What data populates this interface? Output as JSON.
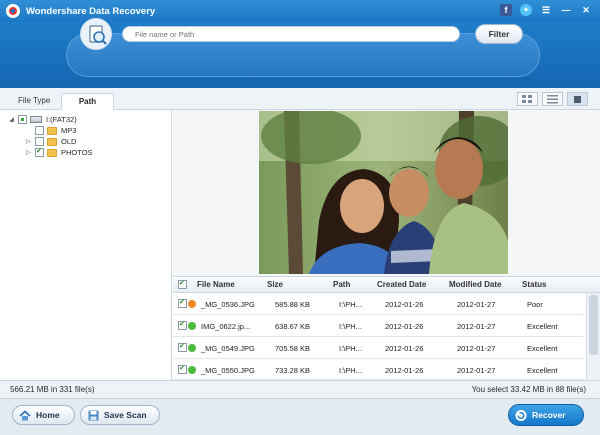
{
  "app": {
    "title": "Wondershare Data Recovery"
  },
  "search": {
    "placeholder": "File name or Path",
    "filter_label": "Filter"
  },
  "tabs": [
    {
      "label": "File Type"
    },
    {
      "label": "Path"
    }
  ],
  "tree": {
    "drive_label": "I:(FAT32)",
    "folders": [
      {
        "label": "MP3"
      },
      {
        "label": "OLD"
      },
      {
        "label": "PHOTOS"
      }
    ]
  },
  "table": {
    "headers": [
      "File Name",
      "Size",
      "Path",
      "Created Date",
      "Modified Date",
      "Status"
    ],
    "rows": [
      {
        "name": "_MG_0536.JPG",
        "size": "585.88 KB",
        "path": "I:\\PH...",
        "created": "2012-01-26",
        "modified": "2012-01-27",
        "status": "Poor",
        "status_color": "#f08a24"
      },
      {
        "name": "IMG_0622.jp...",
        "size": "638.67 KB",
        "path": "I:\\PH...",
        "created": "2012-01-26",
        "modified": "2012-01-27",
        "status": "Excellent",
        "status_color": "#4cbb3c"
      },
      {
        "name": "_MG_0549.JPG",
        "size": "705.58 KB",
        "path": "I:\\PH...",
        "created": "2012-01-26",
        "modified": "2012-01-27",
        "status": "Excellent",
        "status_color": "#4cbb3c"
      },
      {
        "name": "_MG_0550.JPG",
        "size": "733.28 KB",
        "path": "I:\\PH...",
        "created": "2012-01-26",
        "modified": "2012-01-27",
        "status": "Excellent",
        "status_color": "#4cbb3c"
      }
    ]
  },
  "status": {
    "left": "566.21 MB in 331 file(s)",
    "right": "You select 33.42 MB in 88 file(s)"
  },
  "buttons": {
    "home": "Home",
    "save_scan": "Save Scan",
    "recover": "Recover"
  }
}
